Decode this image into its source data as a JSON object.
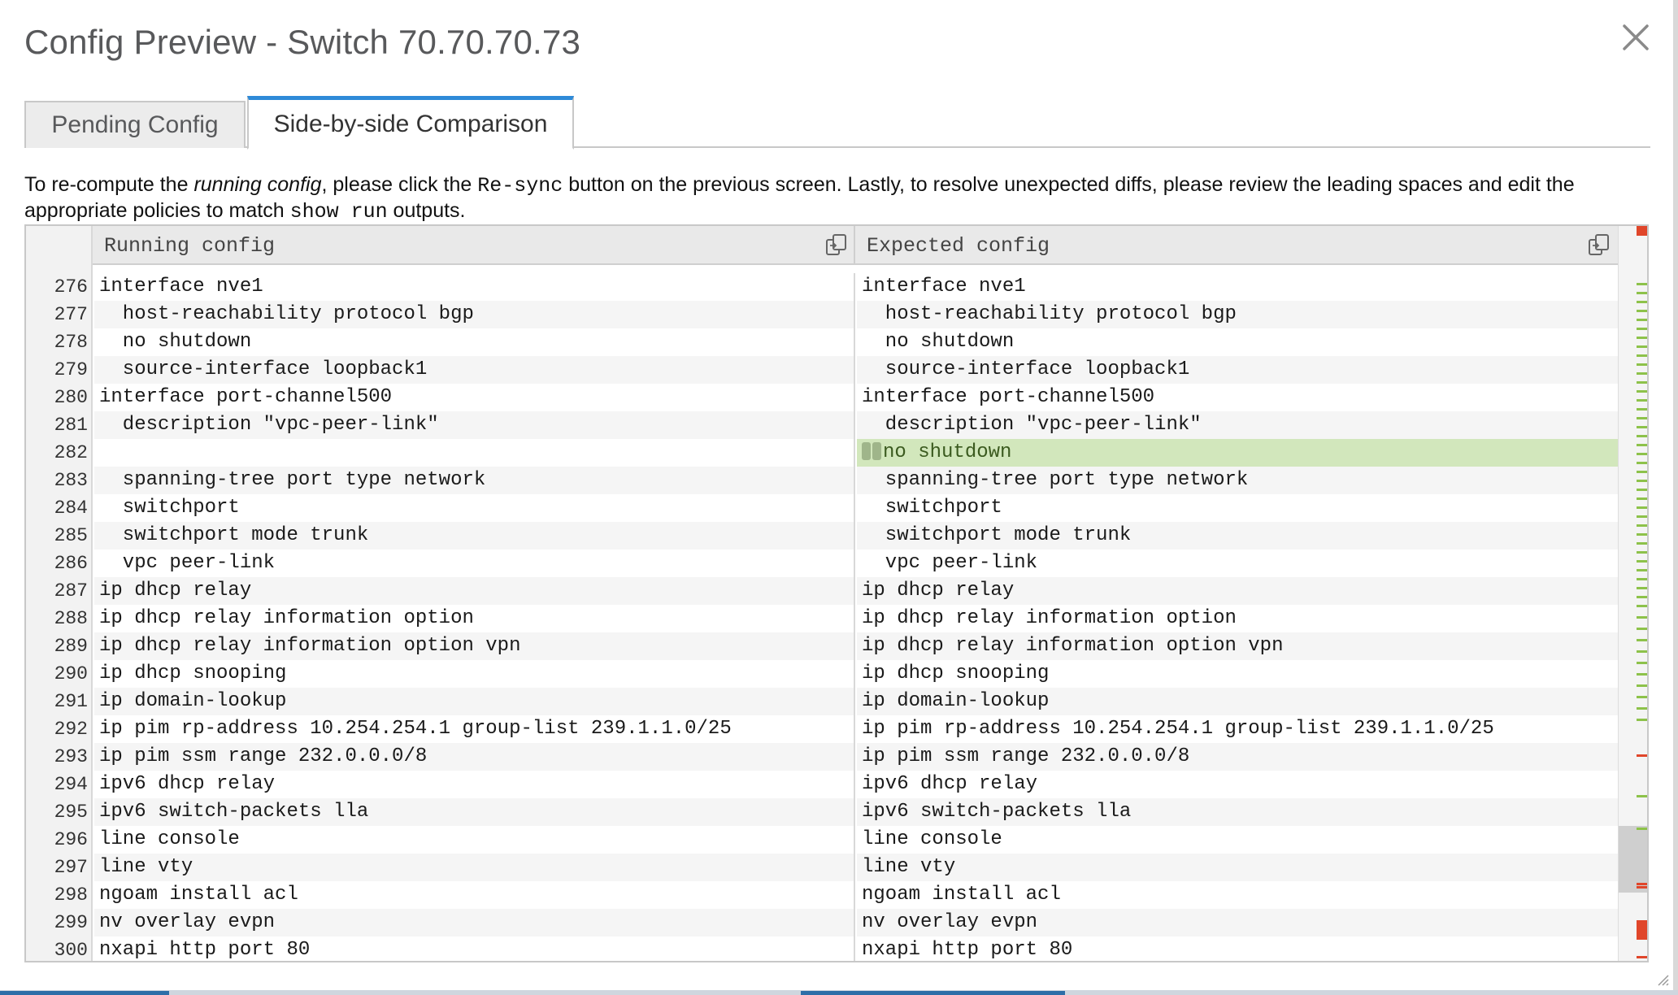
{
  "title": "Config Preview - Switch 70.70.70.73",
  "tabs": [
    {
      "label": "Pending Config"
    },
    {
      "label": "Side-by-side Comparison"
    }
  ],
  "note": {
    "p1": "To re-compute the ",
    "em1": "running config",
    "p2": ", please click the ",
    "code1": "Re-sync",
    "p3": " button on the previous screen. Lastly, to resolve unexpected diffs, please review the leading spaces and edit the appropriate policies to match ",
    "code2": "show run",
    "p4": " outputs."
  },
  "headers": {
    "left": "Running config",
    "right": "Expected config"
  },
  "icons": {
    "close": "close-icon",
    "copy": "copy-icon"
  },
  "colors": {
    "tab_accent": "#2e8ad8",
    "added_bg": "#d2e7bc",
    "marker_green": "#8dc24a",
    "marker_red": "#e0462a"
  },
  "rows": [
    {
      "n": "276",
      "l": "interface nve1",
      "r": "interface nve1"
    },
    {
      "n": "277",
      "l": "  host-reachability protocol bgp",
      "r": "  host-reachability protocol bgp"
    },
    {
      "n": "278",
      "l": "  no shutdown",
      "r": "  no shutdown"
    },
    {
      "n": "279",
      "l": "  source-interface loopback1",
      "r": "  source-interface loopback1"
    },
    {
      "n": "280",
      "l": "interface port-channel500",
      "r": "interface port-channel500"
    },
    {
      "n": "281",
      "l": "  description \"vpc-peer-link\"",
      "r": "  description \"vpc-peer-link\""
    },
    {
      "n": "282",
      "l": "",
      "r": "no shutdown",
      "added": true
    },
    {
      "n": "283",
      "l": "  spanning-tree port type network",
      "r": "  spanning-tree port type network"
    },
    {
      "n": "284",
      "l": "  switchport",
      "r": "  switchport"
    },
    {
      "n": "285",
      "l": "  switchport mode trunk",
      "r": "  switchport mode trunk"
    },
    {
      "n": "286",
      "l": "  vpc peer-link",
      "r": "  vpc peer-link"
    },
    {
      "n": "287",
      "l": "ip dhcp relay",
      "r": "ip dhcp relay"
    },
    {
      "n": "288",
      "l": "ip dhcp relay information option",
      "r": "ip dhcp relay information option"
    },
    {
      "n": "289",
      "l": "ip dhcp relay information option vpn",
      "r": "ip dhcp relay information option vpn"
    },
    {
      "n": "290",
      "l": "ip dhcp snooping",
      "r": "ip dhcp snooping"
    },
    {
      "n": "291",
      "l": "ip domain-lookup",
      "r": "ip domain-lookup"
    },
    {
      "n": "292",
      "l": "ip pim rp-address 10.254.254.1 group-list 239.1.1.0/25",
      "r": "ip pim rp-address 10.254.254.1 group-list 239.1.1.0/25"
    },
    {
      "n": "293",
      "l": "ip pim ssm range 232.0.0.0/8",
      "r": "ip pim ssm range 232.0.0.0/8"
    },
    {
      "n": "294",
      "l": "ipv6 dhcp relay",
      "r": "ipv6 dhcp relay"
    },
    {
      "n": "295",
      "l": "ipv6 switch-packets lla",
      "r": "ipv6 switch-packets lla"
    },
    {
      "n": "296",
      "l": "line console",
      "r": "line console"
    },
    {
      "n": "297",
      "l": "line vty",
      "r": "line vty"
    },
    {
      "n": "298",
      "l": "ngoam install acl",
      "r": "ngoam install acl"
    },
    {
      "n": "299",
      "l": "nv overlay evpn",
      "r": "nv overlay evpn"
    },
    {
      "n": "300",
      "l": "nxapi http port 80",
      "r": "nxapi http port 80"
    }
  ]
}
